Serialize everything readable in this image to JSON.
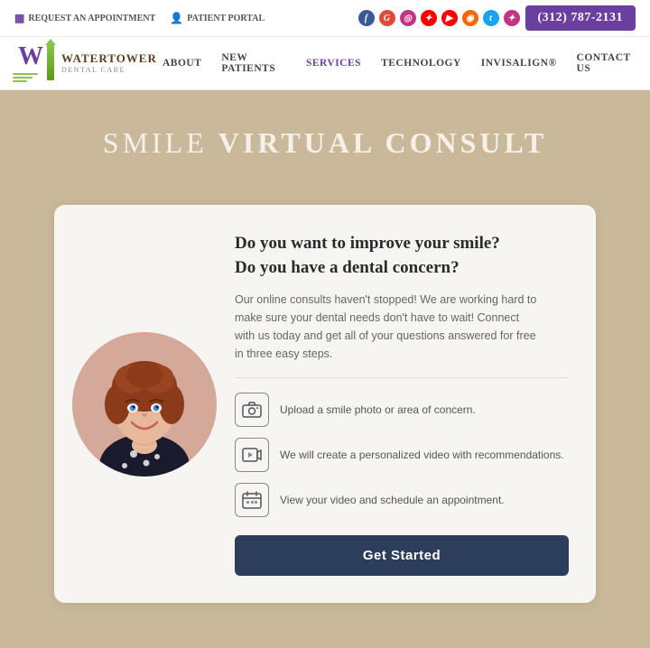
{
  "topbar": {
    "appointment_label": "REQUEST AN APPOINTMENT",
    "portal_label": "PATIENT PORTAL",
    "phone": "(312) 787-2131",
    "socials": [
      "f",
      "G",
      "◎",
      "✿",
      "▶",
      "◉",
      "t",
      "▣"
    ]
  },
  "nav": {
    "logo_name": "WATERTOWER",
    "logo_sub": "DENTAL CARE",
    "links": [
      {
        "label": "ABOUT"
      },
      {
        "label": "NEW PATIENTS"
      },
      {
        "label": "SERVICES"
      },
      {
        "label": "TECHNOLOGY"
      },
      {
        "label": "INVISALIGN®"
      },
      {
        "label": "CONTACT US"
      }
    ]
  },
  "hero": {
    "title_light": "SMILE ",
    "title_bold": "VIRTUAL CONSULT"
  },
  "card": {
    "heading_line1": "Do you want to improve your smile?",
    "heading_line2": "Do you have a dental concern?",
    "description": "Our online consults haven't stopped! We are working hard to make sure your dental needs don't have to wait! Connect with us today and get all of your questions answered for free in three easy steps.",
    "steps": [
      {
        "text": "Upload a smile photo or area of concern."
      },
      {
        "text": "We will create a personalized video with recommendations."
      },
      {
        "text": "View your video and schedule an appointment."
      }
    ],
    "cta_label": "Get Started"
  },
  "colors": {
    "purple": "#6b3fa0",
    "dark_navy": "#2c3e5c",
    "tan_bg": "#c9b99a"
  }
}
